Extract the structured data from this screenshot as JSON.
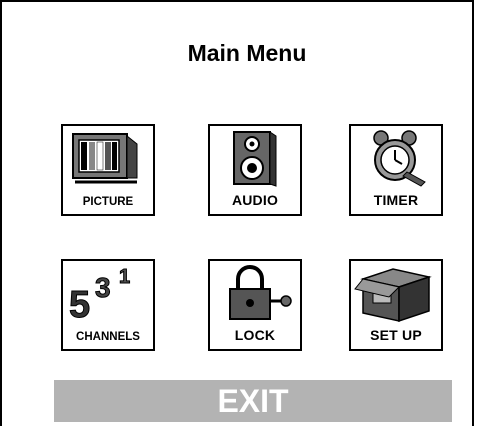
{
  "title": "Main Menu",
  "menu": {
    "picture": {
      "label": "PICTURE",
      "icon": "tv-icon"
    },
    "audio": {
      "label": "AUDIO",
      "icon": "speaker-icon"
    },
    "timer": {
      "label": "TIMER",
      "icon": "alarm-clock-icon"
    },
    "channels": {
      "label": "CHANNELS",
      "icon": "channel-numbers-icon",
      "numerals": [
        "5",
        "3",
        "1"
      ]
    },
    "lock": {
      "label": "LOCK",
      "icon": "padlock-icon"
    },
    "setup": {
      "label": "SET UP",
      "icon": "box-icon"
    }
  },
  "exit_label": "EXIT",
  "colors": {
    "exit_bg": "#b3b3b3",
    "exit_text": "#ffffff"
  }
}
